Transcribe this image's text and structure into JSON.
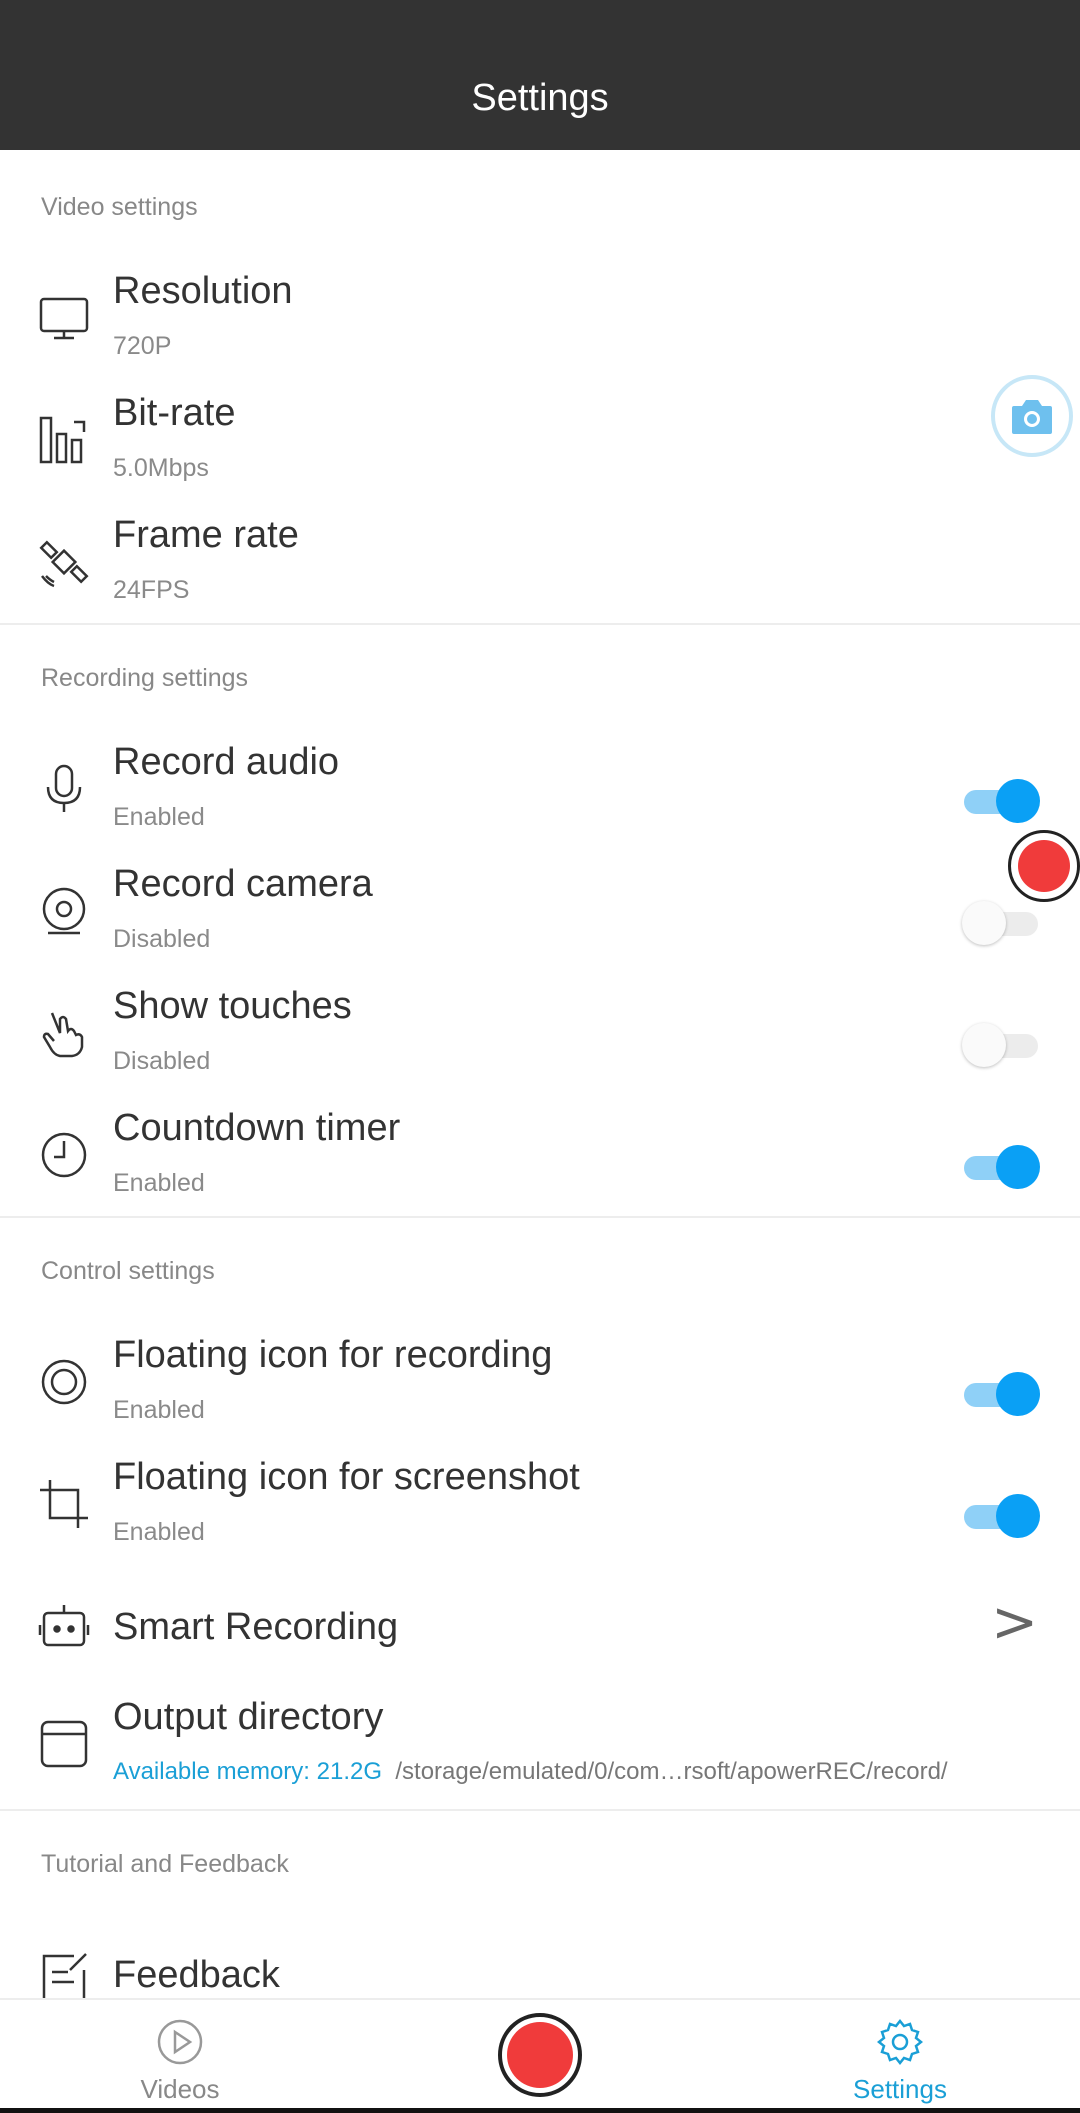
{
  "appbar": {
    "title": "Settings"
  },
  "colors": {
    "appbar_bg": "#333333",
    "accent": "#0aa0f5",
    "record_red": "#f03b3b",
    "memory_text": "#1a9fd6"
  },
  "sections": {
    "video": "Video settings",
    "recording": "Recording settings",
    "control": "Control settings",
    "tutorial": "Tutorial and Feedback"
  },
  "video": {
    "resolution": {
      "title": "Resolution",
      "value": "720P",
      "icon": "monitor-icon"
    },
    "bitrate": {
      "title": "Bit-rate",
      "value": "5.0Mbps",
      "icon": "bar-chart-icon"
    },
    "framerate": {
      "title": "Frame rate",
      "value": "24FPS",
      "icon": "satellite-icon"
    }
  },
  "recording": {
    "audio": {
      "title": "Record audio",
      "value": "Enabled",
      "on": true,
      "icon": "microphone-icon"
    },
    "camera": {
      "title": "Record camera",
      "value": "Disabled",
      "on": false,
      "icon": "webcam-icon"
    },
    "touches": {
      "title": "Show touches",
      "value": "Disabled",
      "on": false,
      "icon": "hand-pointer-icon"
    },
    "countdown": {
      "title": "Countdown timer",
      "value": "Enabled",
      "on": true,
      "icon": "clock-icon"
    }
  },
  "control": {
    "float_record": {
      "title": "Floating icon for recording",
      "value": "Enabled",
      "on": true,
      "icon": "record-ring-icon"
    },
    "float_screenshot": {
      "title": "Floating icon for screenshot",
      "value": "Enabled",
      "on": true,
      "icon": "crop-icon"
    },
    "smart": {
      "title": "Smart Recording",
      "chevron": ">",
      "icon": "robot-icon"
    },
    "output": {
      "title": "Output directory",
      "memory": "Available memory: 21.2G",
      "path": "/storage/emulated/0/com…rsoft/apowerREC/record/",
      "icon": "folder-box-icon"
    }
  },
  "tutorial": {
    "feedback": {
      "title": "Feedback",
      "icon": "edit-document-icon"
    }
  },
  "nav": {
    "videos": "Videos",
    "settings": "Settings",
    "active": "settings"
  }
}
